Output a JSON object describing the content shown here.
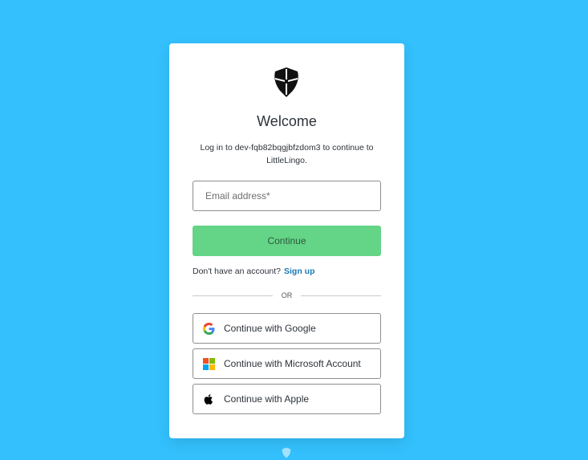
{
  "header": {
    "title": "Welcome",
    "subtitle": "Log in to dev-fqb82bqgjbfzdom3 to continue to LittleLingo."
  },
  "login": {
    "email_placeholder": "Email address*",
    "continue_label": "Continue"
  },
  "signup": {
    "prompt": "Don't have an account?",
    "link_label": "Sign up"
  },
  "divider": {
    "label": "OR"
  },
  "social": [
    {
      "label": "Continue with Google",
      "icon": "google-icon"
    },
    {
      "label": "Continue with Microsoft Account",
      "icon": "microsoft-icon"
    },
    {
      "label": "Continue with Apple",
      "icon": "apple-icon"
    }
  ],
  "colors": {
    "background": "#33c0fd",
    "card": "#ffffff",
    "primary_button": "#64d487",
    "link": "#1a7ab6",
    "text": "#2d333a"
  }
}
